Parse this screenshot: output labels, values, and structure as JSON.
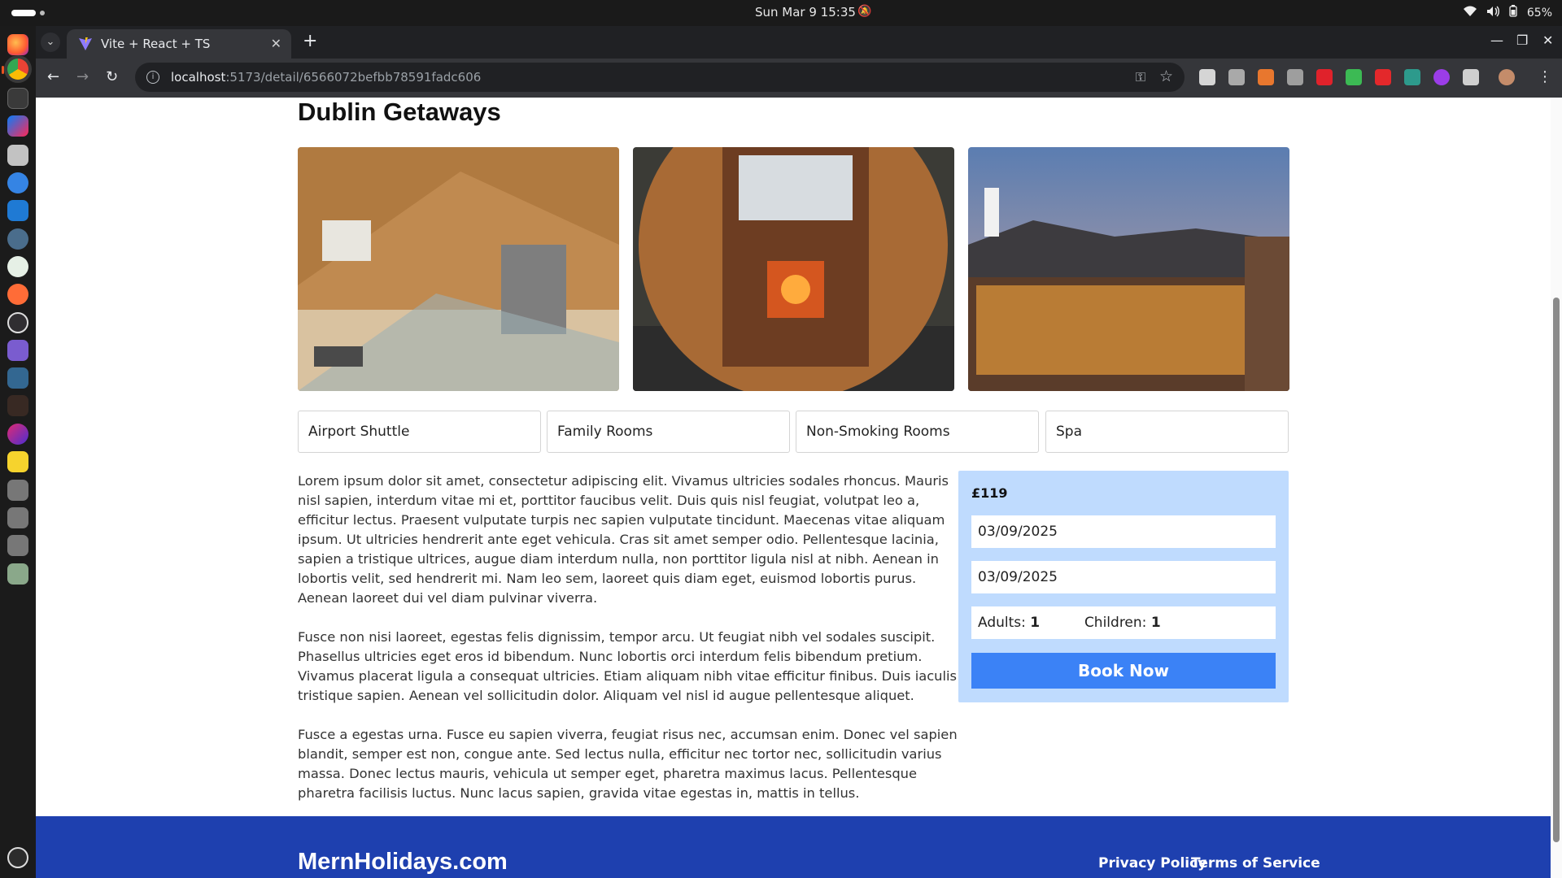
{
  "system": {
    "datetime": "Sun Mar 9  15:35",
    "battery": "65%"
  },
  "browser": {
    "tab_title": "Vite + React + TS",
    "url_host": "localhost",
    "url_path": ":5173/detail/6566072befbb78591fadc606"
  },
  "hotel": {
    "name": "Dublin Getaways",
    "facilities": [
      "Airport Shuttle",
      "Family Rooms",
      "Non-Smoking Rooms",
      "Spa"
    ],
    "description": [
      "Lorem ipsum dolor sit amet, consectetur adipiscing elit. Vivamus ultricies sodales rhoncus. Mauris nisl sapien, interdum vitae mi et, porttitor faucibus velit. Duis quis nisl feugiat, volutpat leo a, efficitur lectus. Praesent vulputate turpis nec sapien vulputate tincidunt. Maecenas vitae aliquam ipsum. Ut ultricies hendrerit ante eget vehicula. Cras sit amet semper odio. Pellentesque lacinia, sapien a tristique ultrices, augue diam interdum nulla, non porttitor ligula nisl at nibh. Aenean in lobortis velit, sed hendrerit mi. Nam leo sem, laoreet quis diam eget, euismod lobortis purus. Aenean laoreet dui vel diam pulvinar viverra.",
      "Fusce non nisi laoreet, egestas felis dignissim, tempor arcu. Ut feugiat nibh vel sodales suscipit. Phasellus ultricies eget eros id bibendum. Nunc lobortis orci interdum felis bibendum pretium. Vivamus placerat ligula a consequat ultricies. Etiam aliquam nibh vitae efficitur finibus. Duis iaculis tristique sapien. Aenean vel sollicitudin dolor. Aliquam vel nisl id augue pellentesque aliquet.",
      "Fusce a egestas urna. Fusce eu sapien viverra, feugiat risus nec, accumsan enim. Donec vel sapien blandit, semper est non, congue ante. Sed lectus nulla, efficitur nec tortor nec, sollicitudin varius massa. Donec lectus mauris, vehicula ut semper eget, pharetra maximus lacus. Pellentesque pharetra facilisis luctus. Nunc lacus sapien, gravida vitae egestas in, mattis in tellus."
    ]
  },
  "booking": {
    "price": "£119",
    "check_in": "03/09/2025",
    "check_out": "03/09/2025",
    "adults_label": "Adults:",
    "adults": "1",
    "children_label": "Children:",
    "children": "1",
    "button": "Book Now"
  },
  "footer": {
    "brand": "MernHolidays.com",
    "privacy": "Privacy Policy",
    "terms": "Terms of Service"
  },
  "colors": {
    "accent": "#3b82f6",
    "footer": "#1e40af",
    "booking_panel": "#bfdbfe"
  }
}
